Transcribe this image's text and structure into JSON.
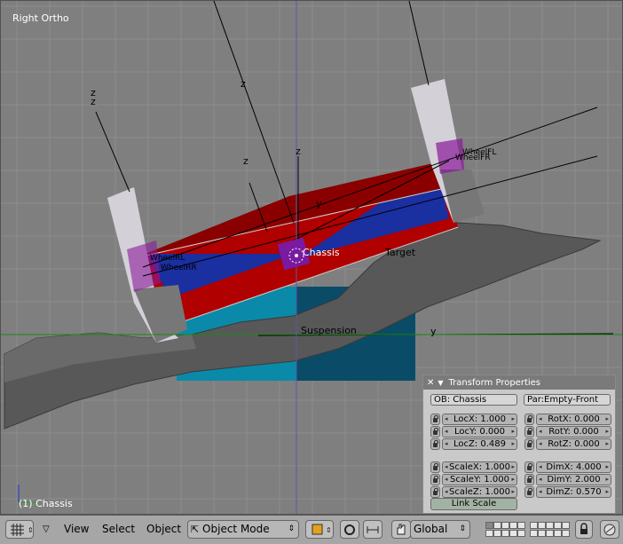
{
  "viewport": {
    "title": "Right Ortho",
    "selected_object": "(1) Chassis",
    "axis_labels": {
      "z": "z",
      "y": "y"
    },
    "object_labels": {
      "chassis": "Chassis",
      "target": "Target",
      "suspension": "Suspension",
      "wheel_fl": "WheelFL",
      "wheel_fr": "WheelFR",
      "wheel_rl": "WheelRL",
      "wheel_rr": "WheelRR"
    }
  },
  "transform_panel": {
    "title": "Transform Properties",
    "ob_field": "OB: Chassis",
    "par_field": "Par:Empty-Front",
    "loc": [
      {
        "label": "LocX:",
        "value": "1.000"
      },
      {
        "label": "LocY:",
        "value": "0.000"
      },
      {
        "label": "LocZ:",
        "value": "0.489"
      }
    ],
    "rot": [
      {
        "label": "RotX:",
        "value": "0.000"
      },
      {
        "label": "RotY:",
        "value": "0.000"
      },
      {
        "label": "RotZ:",
        "value": "0.000"
      }
    ],
    "scale": [
      {
        "label": "ScaleX:",
        "value": "1.000"
      },
      {
        "label": "ScaleY:",
        "value": "1.000"
      },
      {
        "label": "ScaleZ:",
        "value": "1.000"
      }
    ],
    "dim": [
      {
        "label": "DimX:",
        "value": "4.000"
      },
      {
        "label": "DimY:",
        "value": "2.000"
      },
      {
        "label": "DimZ:",
        "value": "0.570"
      }
    ],
    "link_scale": "Link Scale"
  },
  "header": {
    "menus": [
      "View",
      "Select",
      "Object"
    ],
    "mode": "Object Mode",
    "orientation": "Global"
  },
  "colors": {
    "background": "#7f7f7f",
    "grid": "#8a8a8a",
    "chassis_red": "#c00000",
    "chassis_blue": "#1a2fa0",
    "suspension_cyan": "#0a8aa8",
    "suspension_dark": "#0a4b68",
    "ground": "#555555",
    "selected": "#8a1a9a",
    "axis_green": "#1a8a1a"
  }
}
